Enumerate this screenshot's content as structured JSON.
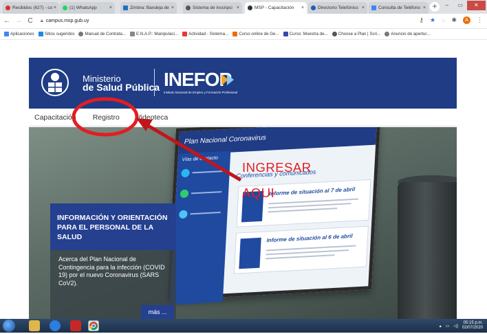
{
  "browser": {
    "tabs": [
      {
        "title": "Recibidos (627) - cov",
        "favicon_color": "#d93025"
      },
      {
        "title": "(1) WhatsApp",
        "favicon_color": "#25d366"
      },
      {
        "title": "Zimbra: Bandeja de e",
        "favicon_color": "#1e73be"
      },
      {
        "title": "Sistema de inscripci",
        "favicon_color": "#555555"
      },
      {
        "title": "MSP - Capacitación",
        "favicon_color": "#333333"
      },
      {
        "title": "Directorio Telefónico",
        "favicon_color": "#1a5fb4"
      },
      {
        "title": "Consulta de Teléfono",
        "favicon_color": "#4285f4"
      }
    ],
    "url": "campus.msp.gub.uy",
    "bookmarks": [
      {
        "label": "Aplicaciones",
        "color": "#4285f4"
      },
      {
        "label": "Sitios sugeridos",
        "color": "#1e88e5"
      },
      {
        "label": "Manual de Contrata...",
        "color": "#777777"
      },
      {
        "label": "E.N.A.P.: Manipulaci...",
        "color": "#888888"
      },
      {
        "label": "Actividad - Sistema...",
        "color": "#e53935"
      },
      {
        "label": "Curso online de Ge...",
        "color": "#ef6c00"
      },
      {
        "label": "Curso: Muestra de...",
        "color": "#3949ab"
      },
      {
        "label": "Choose a Plan | Scri...",
        "color": "#555555"
      },
      {
        "label": "Anuncio de apertur...",
        "color": "#777777"
      }
    ],
    "profile_initial": "A"
  },
  "site": {
    "ministerio_line1": "Ministerio",
    "ministerio_line2": "de Salud Pública",
    "inefop": "INEFOP",
    "inefop_sub": "Instituto Nacional de Empleo y Formación Profesional",
    "menu": [
      "Capacitación",
      "Registro",
      "Videoteca"
    ],
    "laptop": {
      "plan_title": "Plan Nacional Coronavirus",
      "contact_label": "Vías de contacto",
      "section": "Conferencias y comunicados",
      "card1_title": "Informe de situación al 7 de abril",
      "card2_title": "Informe de situación al 6 de abril"
    },
    "info": {
      "heading": "INFORMACIÓN Y ORIENTACIÓN PARA EL PERSONAL DE LA SALUD",
      "body": "Acerca del Plan Nacional de Contingencia para la infección (COVID 19) por el nuevo Coronavirus (SARS CoV2).",
      "more": "más ..."
    }
  },
  "annotation": {
    "line1": "INGRESAR",
    "line2": "AQUI",
    "color": "#e31d22"
  },
  "taskbar": {
    "time": "05:15 p.m.",
    "date": "02/07/2020"
  }
}
